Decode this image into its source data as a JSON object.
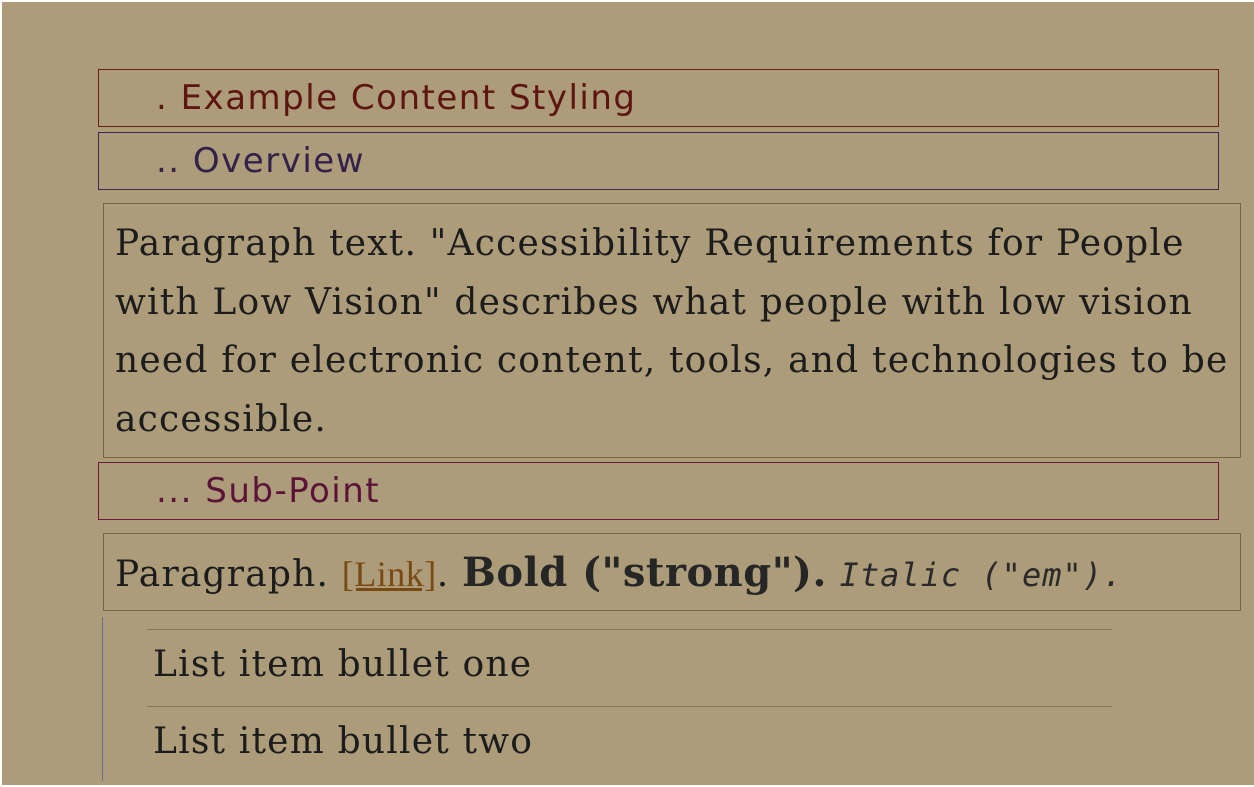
{
  "colors": {
    "background": "#ac9c7a",
    "h1_text": "#5e1510",
    "h2_text": "#34214a",
    "h3_text": "#5b1438",
    "link": "#7a4a14",
    "body_text": "#1c1c1c"
  },
  "headings": {
    "h1": ". Example Content Styling",
    "h2": ".. Overview",
    "h3": "... Sub-Point"
  },
  "paragraphs": {
    "intro": "Paragraph text. \"Accessibility Requirements for People with Low Vision\" describes what people with low vision need for electronic content, tools, and technologies to be accessible.",
    "styled": {
      "lead": "Paragraph. ",
      "link": "[Link]",
      "after_link": ". ",
      "bold": "Bold (\"strong\").",
      "space": " ",
      "italic": "Italic (\"em\")."
    }
  },
  "list": {
    "items": [
      "List item bullet one",
      "List item bullet two"
    ]
  }
}
